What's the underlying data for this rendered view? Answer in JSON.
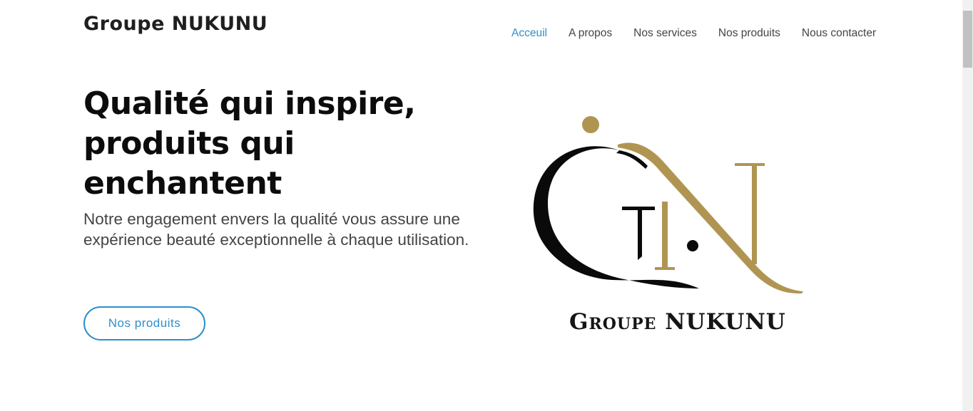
{
  "header": {
    "brand": "Groupe NUKUNU",
    "nav": [
      {
        "label": "Acceuil",
        "active": true
      },
      {
        "label": "A propos",
        "active": false
      },
      {
        "label": "Nos services",
        "active": false
      },
      {
        "label": "Nos produits",
        "active": false
      },
      {
        "label": "Nous contacter",
        "active": false
      }
    ]
  },
  "hero": {
    "title": "Qualité qui inspire, produits qui enchantent",
    "subtitle": "Notre engagement envers la qualité vous assure une expérience beauté exceptionnelle à chaque utilisation.",
    "cta_label": "Nos produits"
  },
  "logo": {
    "text": "Groupe NUKUNU",
    "gold_color": "#b09552",
    "black_color": "#0a0a0a"
  },
  "colors": {
    "accent": "#2e8fcc"
  }
}
